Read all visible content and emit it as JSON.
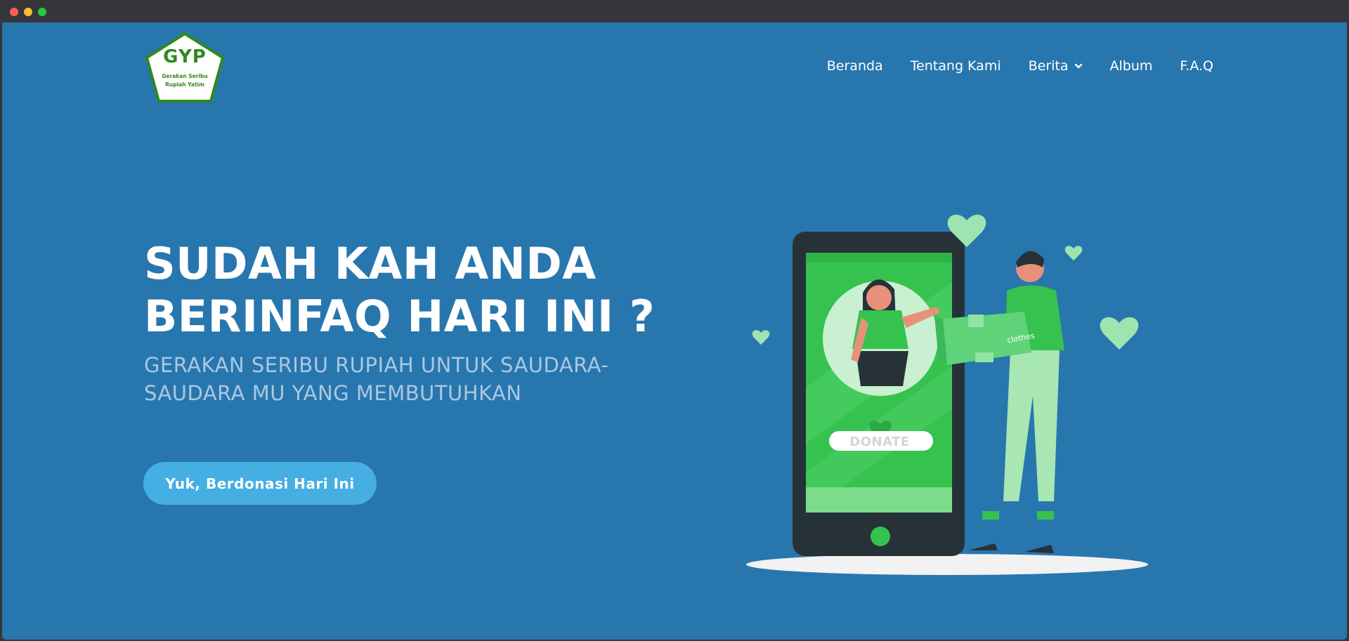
{
  "logo": {
    "brand": "GYP",
    "tagline_line1": "Gerakan Seribu",
    "tagline_line2": "Rupiah Yatim"
  },
  "nav": {
    "items": [
      {
        "label": "Beranda"
      },
      {
        "label": "Tentang Kami"
      },
      {
        "label": "Berita",
        "has_dropdown": true
      },
      {
        "label": "Album"
      },
      {
        "label": "F.A.Q"
      }
    ]
  },
  "hero": {
    "title_line1": "SUDAH KAH ANDA",
    "title_line2": "BERINFAQ HARI INI ?",
    "subtitle_line1": "GERAKAN SERIBU RUPIAH UNTUK SAUDARA-",
    "subtitle_line2": "SAUDARA MU YANG MEMBUTUHKAN",
    "cta_label": "Yuk, Berdonasi Hari Ini"
  },
  "illustration": {
    "phone_button_label": "DONATE",
    "box_label": "clothes"
  },
  "colors": {
    "page_background": "#2876ae",
    "cta_background": "#45aee3",
    "subtitle_color": "#a9c8e2",
    "logo_green": "#2f8a1e",
    "phone_screen_green": "#36c24f",
    "heart_green": "#9de4b1"
  }
}
